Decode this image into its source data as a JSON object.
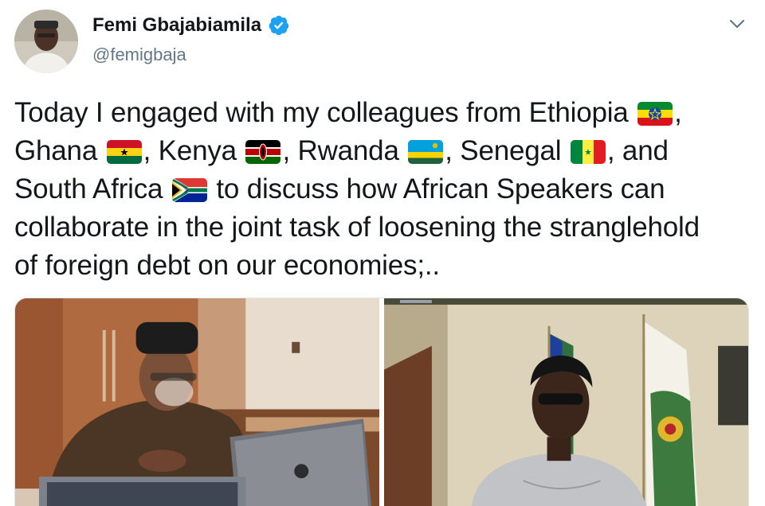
{
  "tweet": {
    "author": {
      "display_name": "Femi Gbajabiamila",
      "handle": "@femigbaja",
      "verified": true,
      "avatar_icon": "profile-photo"
    },
    "menu_icon": "chevron-down-icon",
    "text": {
      "l1_a": "Today I engaged with my colleagues from Ethiopia ",
      "l1_b": ",",
      "l2_a": "Ghana ",
      "l2_b": ", Kenya ",
      "l2_c": ", Rwanda ",
      "l2_d": ", Senegal ",
      "l2_e": ", and",
      "l3_a": "South Africa ",
      "l3_b": " to discuss how African Speakers can",
      "l4": "collaborate in the joint task of loosening the stranglehold",
      "l5": "of foreign debt on our economies;.."
    },
    "flags": [
      "ethiopia-flag",
      "ghana-flag",
      "kenya-flag",
      "rwanda-flag",
      "senegal-flag",
      "south-africa-flag"
    ],
    "media": [
      {
        "name": "photo-speaker-at-laptop",
        "alt": "Man in cap working on laptop at desk"
      },
      {
        "name": "photo-video-call-speaker",
        "alt": "Woman speaking in video call with flags behind"
      }
    ],
    "colors": {
      "verified_blue": "#1da1f2",
      "handle_gray": "#657786",
      "text": "#14171a"
    }
  }
}
